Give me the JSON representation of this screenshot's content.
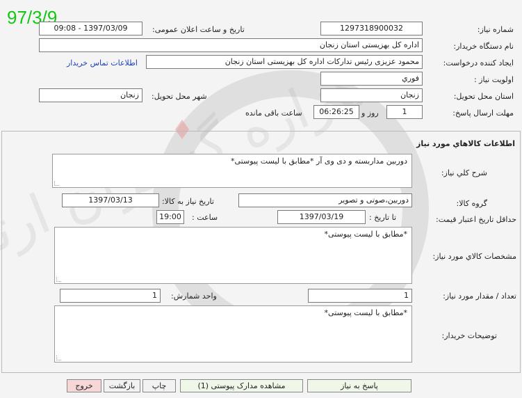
{
  "date_stamp": "97/3/9",
  "watermark_text": "هزاره گستران ارتباط",
  "header": {
    "need_number_label": "شماره نیاز:",
    "need_number": "1297318900032",
    "announce_label": "تاریخ و ساعت اعلان عمومی:",
    "announce_value": "1397/03/09 - 09:08",
    "buyer_org_label": "نام دستگاه خریدار:",
    "buyer_org": "اداره کل بهزیستی استان زنجان",
    "creator_label": "ایجاد کننده درخواست:",
    "creator": "محمود  عزیزی رئیس تدارکات اداره کل بهزیستی استان زنجان",
    "contact_link": "اطلاعات تماس خریدار",
    "priority_label": "اولویت نیاز :",
    "priority": "فوري",
    "province_label": "استان محل تحویل:",
    "province": "زنجان",
    "city_label": "شهر محل تحویل:",
    "city": "زنجان",
    "deadline_label": "مهلت ارسال پاسخ:",
    "days": "1",
    "days_suffix": "روز و",
    "time_left": "06:26:25",
    "time_left_suffix": "ساعت باقی مانده"
  },
  "goods": {
    "section_title": "اطلاعات کالاهاي مورد نياز",
    "summary_label": "شرح کلي نياز:",
    "summary": "دوربین مداربسته و دی وی آر  *مطابق با لیست پیوستی*",
    "group_label": "گروه کالا:",
    "group": "دوربین،صوتی و تصویر",
    "need_date_label": "تاریخ نیاز به کالا:",
    "need_date": "1397/03/13",
    "min_validity_label": "حداقل تاریخ اعتبار قیمت:",
    "until_label": "تا تاریخ :",
    "until_date": "1397/03/19",
    "time_label": "ساعت :",
    "time": "19:00",
    "specs_label": "مشخصات کالاي مورد نياز:",
    "specs": "*مطابق با لیست پیوستی*",
    "quantity_label": "تعداد / مقدار مورد نیاز:",
    "quantity": "1",
    "unit_label": "واحد شمارش:",
    "unit": "1",
    "buyer_notes_label": "توضيحات خريدار:",
    "buyer_notes": "*مطابق با لیست پیوستی*"
  },
  "actions": {
    "respond": "پاسخ به نیاز",
    "view_attachments": "مشاهده مدارک پیوستی (1)",
    "print": "چاپ",
    "back": "بازگشت",
    "exit": "خروج"
  }
}
